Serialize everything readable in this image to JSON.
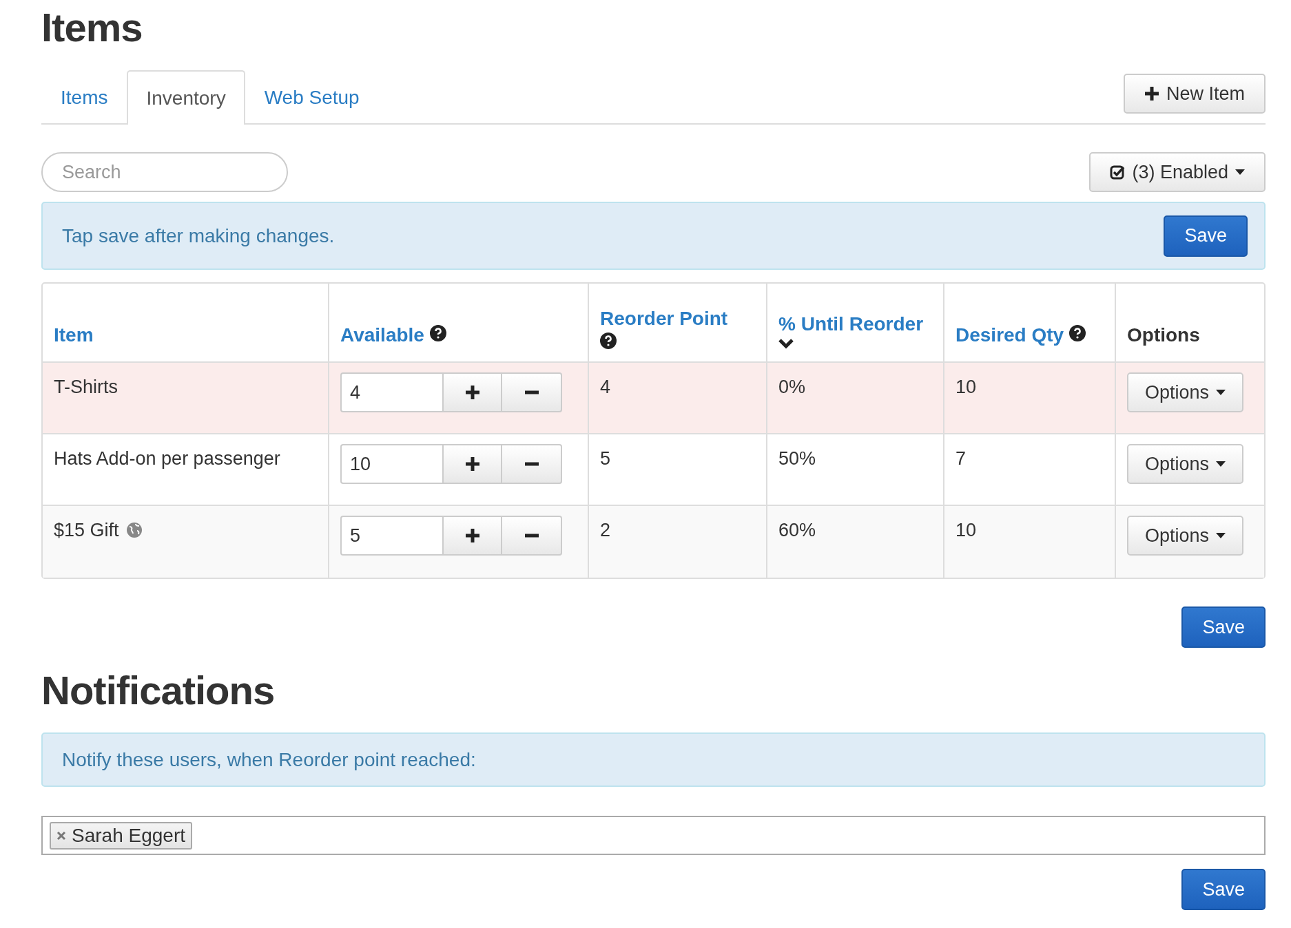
{
  "page_title": "Items",
  "tabs": [
    {
      "label": "Items",
      "selected": false
    },
    {
      "label": "Inventory",
      "selected": true
    },
    {
      "label": "Web Setup",
      "selected": false
    }
  ],
  "new_item_button": "New Item",
  "search": {
    "placeholder": "Search"
  },
  "filter_button": "(3) Enabled",
  "save_alert": {
    "text": "Tap save after making changes.",
    "button": "Save"
  },
  "table": {
    "columns": [
      {
        "label": "Item",
        "link": true,
        "help": false,
        "sorted": false
      },
      {
        "label": "Available",
        "link": true,
        "help": true,
        "sorted": false
      },
      {
        "label": "Reorder Point",
        "link": true,
        "help": true,
        "sorted": false
      },
      {
        "label": "% Until Reorder",
        "link": true,
        "help": false,
        "sorted": true
      },
      {
        "label": "Desired Qty",
        "link": true,
        "help": true,
        "sorted": false
      },
      {
        "label": "Options",
        "link": false,
        "help": false,
        "sorted": false
      }
    ],
    "rows": [
      {
        "item": "T-Shirts",
        "globe": false,
        "low_stock": true,
        "available": "4",
        "reorder_point": "4",
        "until_reorder": "0%",
        "desired_qty": "10",
        "options": "Options"
      },
      {
        "item": "Hats Add-on per passenger",
        "globe": false,
        "low_stock": false,
        "available": "10",
        "reorder_point": "5",
        "until_reorder": "50%",
        "desired_qty": "7",
        "options": "Options"
      },
      {
        "item": "$15 Gift",
        "globe": true,
        "low_stock": false,
        "available": "5",
        "reorder_point": "2",
        "until_reorder": "60%",
        "desired_qty": "10",
        "options": "Options"
      }
    ]
  },
  "table_save_button": "Save",
  "notifications": {
    "title": "Notifications",
    "alert": "Notify these users, when Reorder point reached:",
    "users": [
      "Sarah Eggert"
    ],
    "save_button": "Save"
  }
}
